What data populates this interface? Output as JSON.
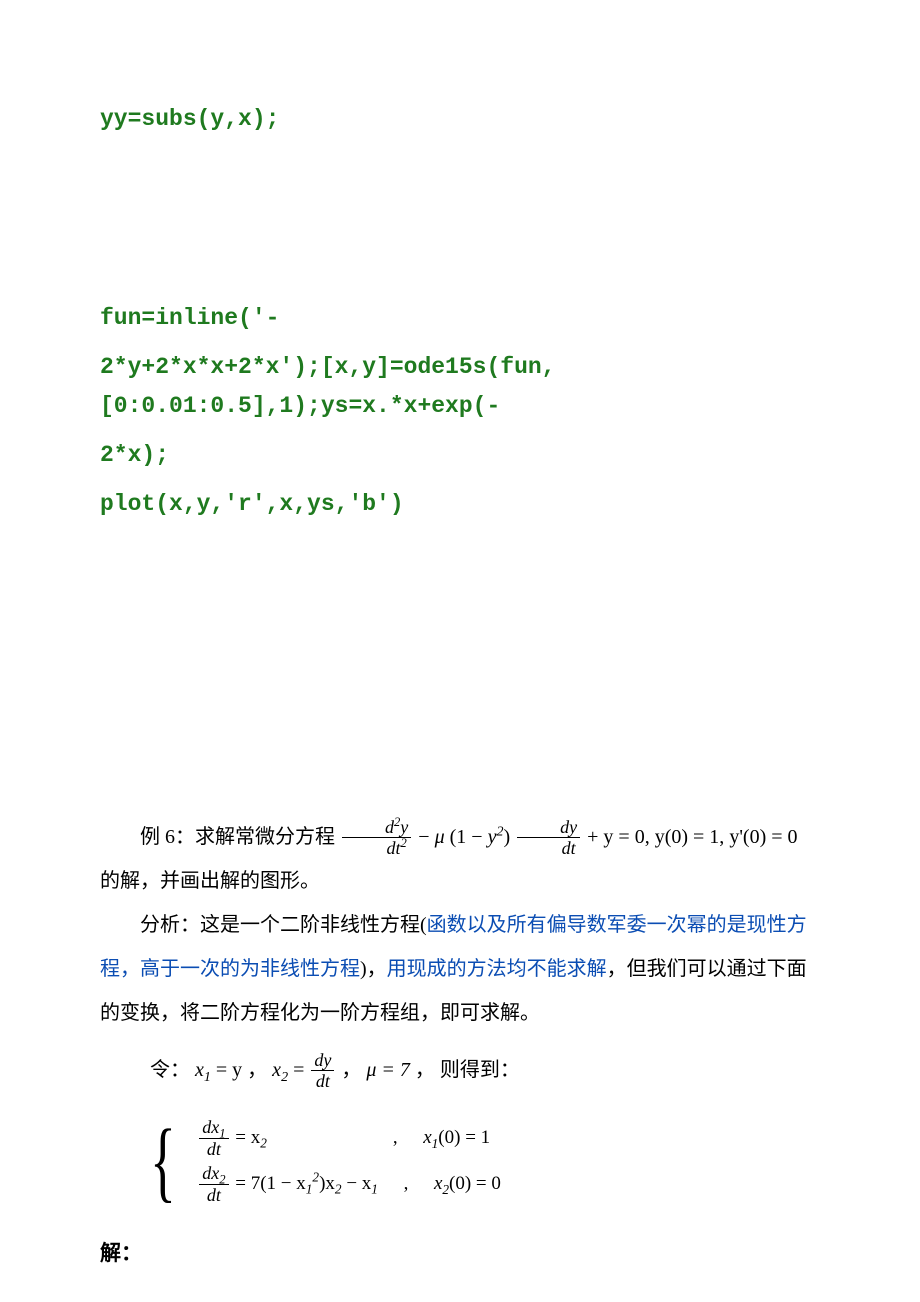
{
  "code": {
    "l1": "yy=subs(y,x);",
    "l2a": "fun=inline('-",
    "l2b": "2*y+2*x*x+2*x');[x,y]=ode15s(fun,[0:0.01:0.5],1);ys=x.*x+exp(-",
    "l2c": "2*x);",
    "l3": "plot(x,y,'r',x,ys,'b')"
  },
  "example": {
    "label": "例 6：求解常微分方程 ",
    "ode_suffix": " 的解，并画出解的图形。",
    "analysis_pre": "分析：这是一个二阶非线性方程(",
    "analysis_blue1": "函数以及所有偏导数军委一次幂的是现性方程，高于一次的为非线性方程",
    "analysis_mid": ")，",
    "analysis_blue2": "用现成的方法均不能求解",
    "analysis_tail": "，但我们可以通过下面的变换，将二阶方程化为一阶方程组，即可求解。",
    "let_pre": "令：",
    "let_sep": " ， ",
    "mu_eq": "μ = 7",
    "let_tail": " ，  则得到：",
    "solve": "解："
  },
  "math": {
    "ode": {
      "d2y": "d",
      "sq": "2",
      "y": "y",
      "dt": "dt",
      "minus": " − ",
      "mu": "μ",
      "one_minus_y2_a": "(1 − ",
      "one_minus_y2_b": ")",
      "dy": "dy",
      "plus_y": " + y = 0, ",
      "ic1": "y(0) = 1, ",
      "ic2": "y'(0) = 0"
    },
    "sub": {
      "x1_eq_y_a": "x",
      "x1_eq_y_b": " = y",
      "x2_eq": "x",
      "eq": " = "
    },
    "sys": {
      "r1_lhs_num": "dx",
      "r1_lhs_den": "dt",
      "r1_rhs": " = x",
      "r1_sub": "2",
      "r1_ic": "x",
      "r1_ic_sub": "1",
      "r1_ic_rest": "(0) = 1",
      "r2_lhs_num": "dx",
      "r2_lhs_den": "dt",
      "r2_rhs_a": " = 7(1 − x",
      "r2_rhs_b": ")x",
      "r2_rhs_c": " − x",
      "r2_ic": "x",
      "r2_ic_sub": "2",
      "r2_ic_rest": "(0) = 0"
    }
  }
}
